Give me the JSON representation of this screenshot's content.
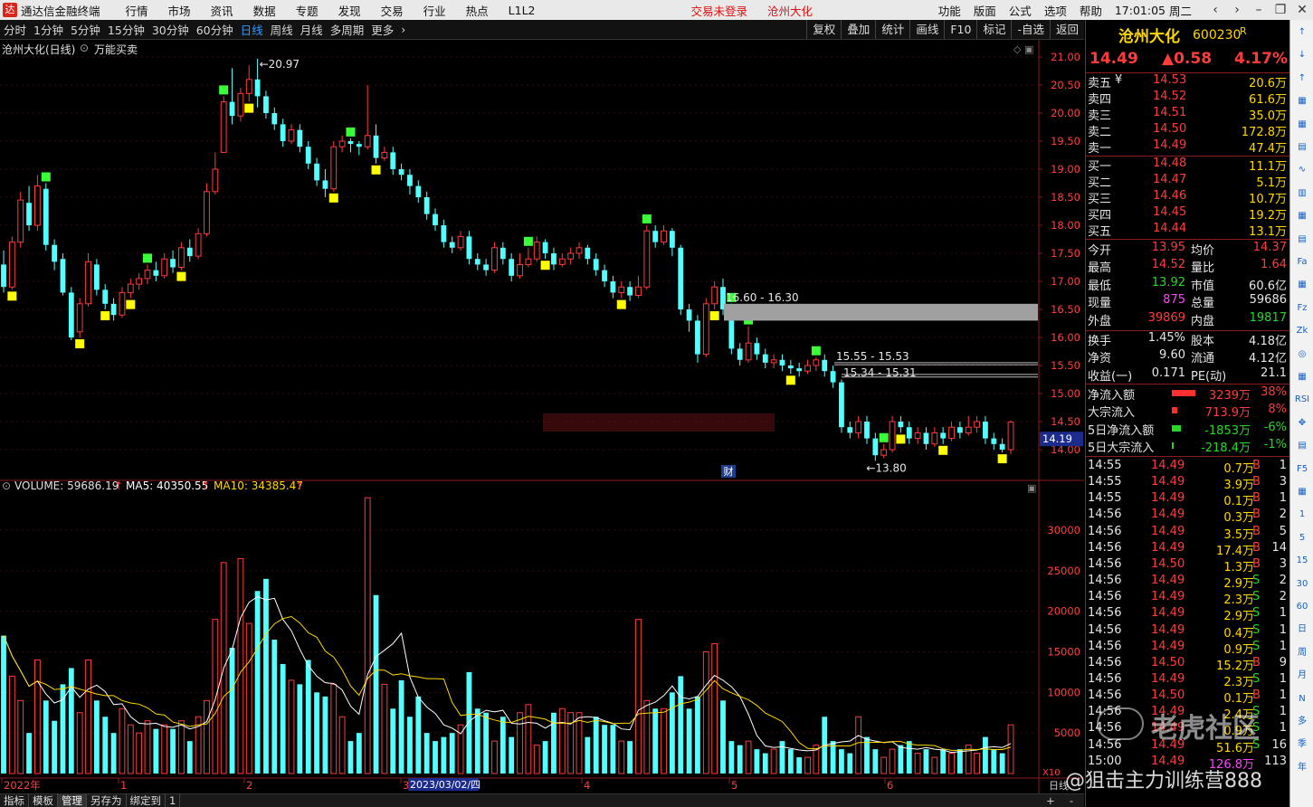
{
  "menubar": {
    "app_title": "通达信金融终端",
    "items": [
      "行情",
      "市场",
      "资讯",
      "数据",
      "专题",
      "发现",
      "交易",
      "行业",
      "热点",
      "L1L2"
    ],
    "login_status": "交易未登录",
    "stock_name": "沧州大化",
    "right_items": [
      "功能",
      "版面",
      "公式",
      "选项",
      "帮助"
    ],
    "time": "17:01:05",
    "weekday": "周二"
  },
  "periodbar": {
    "periods": [
      "分时",
      "1分钟",
      "5分钟",
      "15分钟",
      "30分钟",
      "60分钟",
      "日线",
      "周线",
      "月线",
      "多周期",
      "更多"
    ],
    "active": "日线",
    "tools": [
      "复权",
      "叠加",
      "统计",
      "画线",
      "F10",
      "标记",
      "-自选",
      "返回"
    ]
  },
  "chart": {
    "title": "沧州大化(日线)",
    "indicator": "万能买卖",
    "current_price_tag": "14.19",
    "fin_marker": "财",
    "annotations": {
      "high": "20.97",
      "low": "13.80",
      "zone1": "16.60 - 16.30",
      "zone2": "15.55 - 15.53",
      "zone3": "15.34 - 15.31"
    },
    "volume_label": "VOLUME: 59686.19",
    "ma5_label": "MA5: 40350.55",
    "ma10_label": "MA10: 34385.47",
    "x_labels": [
      "2022年",
      "1",
      "2",
      "3",
      "4",
      "5",
      "6"
    ],
    "date_cursor": "2023/03/02/四",
    "vol_unit": "日线",
    "x10": "X10"
  },
  "chart_data": {
    "type": "candlestick",
    "price_axis": {
      "min": 13.6,
      "max": 21.2,
      "ticks": [
        "21.00",
        "20.50",
        "20.00",
        "19.50",
        "19.00",
        "18.50",
        "18.00",
        "17.50",
        "17.00",
        "16.50",
        "16.00",
        "15.50",
        "15.00",
        "14.50",
        "14.00"
      ]
    },
    "volume_axis": {
      "min": 0,
      "max": 35000,
      "ticks": [
        "30000",
        "25000",
        "20000",
        "15000",
        "10000",
        "5000"
      ]
    },
    "candles": [
      [
        17.3,
        16.9,
        17.55,
        16.8
      ],
      [
        16.9,
        17.7,
        17.8,
        16.85
      ],
      [
        17.7,
        18.45,
        18.6,
        17.6
      ],
      [
        18.4,
        18.0,
        18.7,
        17.9
      ],
      [
        18.0,
        18.7,
        18.9,
        17.9
      ],
      [
        18.65,
        17.65,
        18.75,
        17.55
      ],
      [
        17.65,
        17.35,
        17.75,
        17.2
      ],
      [
        17.4,
        16.8,
        17.5,
        16.75
      ],
      [
        16.8,
        16.0,
        16.9,
        15.95
      ],
      [
        16.1,
        16.6,
        16.7,
        16.0
      ],
      [
        16.6,
        17.35,
        17.5,
        16.55
      ],
      [
        17.3,
        16.85,
        17.4,
        16.75
      ],
      [
        16.85,
        16.6,
        16.95,
        16.5
      ],
      [
        16.6,
        16.4,
        16.7,
        16.3
      ],
      [
        16.4,
        16.8,
        16.9,
        16.35
      ],
      [
        16.8,
        16.95,
        17.05,
        16.7
      ],
      [
        16.95,
        17.05,
        17.15,
        16.85
      ],
      [
        17.05,
        17.2,
        17.3,
        16.95
      ],
      [
        17.2,
        17.1,
        17.35,
        17.0
      ],
      [
        17.1,
        17.4,
        17.5,
        17.05
      ],
      [
        17.4,
        17.25,
        17.55,
        17.15
      ],
      [
        17.25,
        17.6,
        17.7,
        17.2
      ],
      [
        17.6,
        17.45,
        17.75,
        17.35
      ],
      [
        17.45,
        17.85,
        17.95,
        17.4
      ],
      [
        17.85,
        18.6,
        18.75,
        17.8
      ],
      [
        18.6,
        19.0,
        19.3,
        18.55
      ],
      [
        19.3,
        20.2,
        20.3,
        19.3
      ],
      [
        20.2,
        19.95,
        20.8,
        19.8
      ],
      [
        19.95,
        20.35,
        20.45,
        19.85
      ],
      [
        20.35,
        20.6,
        20.85,
        20.2
      ],
      [
        20.6,
        20.3,
        20.97,
        20.1
      ],
      [
        20.3,
        20.0,
        20.4,
        19.9
      ],
      [
        20.0,
        19.8,
        20.1,
        19.7
      ],
      [
        19.8,
        19.5,
        19.9,
        19.4
      ],
      [
        19.5,
        19.7,
        19.8,
        19.45
      ],
      [
        19.7,
        19.4,
        19.8,
        19.3
      ],
      [
        19.4,
        19.1,
        19.5,
        19.0
      ],
      [
        19.1,
        18.8,
        19.2,
        18.7
      ],
      [
        18.8,
        18.65,
        19.0,
        18.5
      ],
      [
        18.65,
        19.4,
        19.5,
        18.6
      ],
      [
        19.4,
        19.5,
        19.6,
        19.3
      ],
      [
        19.5,
        19.45,
        19.55,
        19.3
      ],
      [
        19.45,
        19.4,
        19.5,
        19.25
      ],
      [
        19.4,
        19.6,
        20.5,
        19.35
      ],
      [
        19.6,
        19.2,
        19.8,
        19.1
      ],
      [
        19.2,
        19.3,
        19.4,
        19.15
      ],
      [
        19.3,
        19.0,
        19.4,
        18.9
      ],
      [
        19.0,
        18.9,
        19.1,
        18.8
      ],
      [
        18.9,
        18.7,
        19.0,
        18.55
      ],
      [
        18.7,
        18.5,
        18.8,
        18.4
      ],
      [
        18.5,
        18.2,
        18.6,
        18.1
      ],
      [
        18.2,
        18.0,
        18.3,
        17.9
      ],
      [
        18.0,
        17.7,
        18.1,
        17.6
      ],
      [
        17.7,
        17.6,
        17.8,
        17.5
      ],
      [
        17.6,
        17.8,
        17.9,
        17.55
      ],
      [
        17.8,
        17.4,
        17.9,
        17.3
      ],
      [
        17.4,
        17.3,
        17.5,
        17.2
      ],
      [
        17.3,
        17.2,
        17.4,
        17.1
      ],
      [
        17.2,
        17.6,
        17.7,
        17.15
      ],
      [
        17.6,
        17.4,
        17.7,
        17.3
      ],
      [
        17.4,
        17.1,
        17.5,
        17.0
      ],
      [
        17.1,
        17.3,
        17.5,
        17.05
      ],
      [
        17.3,
        17.4,
        17.6,
        17.25
      ],
      [
        17.4,
        17.7,
        17.8,
        17.35
      ],
      [
        17.7,
        17.5,
        17.75,
        17.4
      ],
      [
        17.5,
        17.3,
        17.6,
        17.2
      ],
      [
        17.3,
        17.4,
        17.5,
        17.25
      ],
      [
        17.4,
        17.5,
        17.6,
        17.3
      ],
      [
        17.5,
        17.6,
        17.7,
        17.4
      ],
      [
        17.6,
        17.4,
        17.65,
        17.3
      ],
      [
        17.4,
        17.2,
        17.5,
        17.1
      ],
      [
        17.2,
        17.0,
        17.3,
        16.9
      ],
      [
        17.0,
        16.8,
        17.1,
        16.7
      ],
      [
        16.8,
        16.9,
        17.0,
        16.7
      ],
      [
        16.9,
        16.75,
        17.0,
        16.65
      ],
      [
        16.75,
        16.9,
        17.1,
        16.7
      ],
      [
        16.9,
        17.9,
        18.0,
        16.85
      ],
      [
        17.9,
        17.7,
        18.0,
        17.6
      ],
      [
        17.7,
        17.9,
        18.0,
        17.65
      ],
      [
        17.9,
        17.6,
        17.95,
        17.45
      ],
      [
        17.6,
        16.5,
        17.65,
        16.4
      ],
      [
        16.5,
        16.3,
        16.6,
        16.1
      ],
      [
        16.3,
        15.7,
        16.4,
        15.55
      ],
      [
        15.7,
        16.6,
        16.7,
        15.65
      ],
      [
        16.6,
        16.9,
        17.0,
        16.5
      ],
      [
        16.9,
        16.5,
        17.05,
        16.4
      ],
      [
        16.5,
        15.8,
        16.6,
        15.7
      ],
      [
        15.8,
        15.6,
        15.9,
        15.5
      ],
      [
        15.6,
        15.9,
        16.2,
        15.55
      ],
      [
        15.9,
        15.7,
        16.0,
        15.6
      ],
      [
        15.7,
        15.55,
        15.8,
        15.45
      ],
      [
        15.55,
        15.6,
        15.7,
        15.45
      ],
      [
        15.6,
        15.5,
        15.7,
        15.4
      ],
      [
        15.5,
        15.45,
        15.6,
        15.35
      ],
      [
        15.45,
        15.4,
        15.55,
        15.3
      ],
      [
        15.4,
        15.5,
        15.6,
        15.35
      ],
      [
        15.5,
        15.6,
        15.65,
        15.4
      ],
      [
        15.6,
        15.4,
        15.7,
        15.3
      ],
      [
        15.4,
        15.2,
        15.5,
        15.1
      ],
      [
        15.2,
        14.4,
        15.25,
        14.3
      ],
      [
        14.4,
        14.3,
        14.5,
        14.2
      ],
      [
        14.3,
        14.5,
        14.6,
        14.2
      ],
      [
        14.5,
        14.2,
        14.6,
        14.1
      ],
      [
        14.2,
        13.9,
        14.3,
        13.8
      ],
      [
        13.9,
        14.0,
        14.1,
        13.85
      ],
      [
        14.0,
        14.5,
        14.6,
        13.95
      ],
      [
        14.5,
        14.4,
        14.6,
        14.3
      ],
      [
        14.4,
        14.2,
        14.5,
        14.1
      ],
      [
        14.2,
        14.3,
        14.4,
        14.1
      ],
      [
        14.3,
        14.1,
        14.4,
        14.0
      ],
      [
        14.1,
        14.3,
        14.4,
        14.05
      ],
      [
        14.3,
        14.2,
        14.4,
        14.1
      ],
      [
        14.2,
        14.4,
        14.5,
        14.15
      ],
      [
        14.4,
        14.3,
        14.5,
        14.2
      ],
      [
        14.3,
        14.4,
        14.6,
        14.25
      ],
      [
        14.4,
        14.5,
        14.6,
        14.3
      ],
      [
        14.5,
        14.2,
        14.6,
        14.1
      ],
      [
        14.2,
        14.1,
        14.3,
        14.0
      ],
      [
        14.1,
        14.0,
        14.2,
        13.95
      ],
      [
        14.0,
        14.49,
        14.52,
        13.92
      ]
    ],
    "volumes": [
      17000,
      12000,
      9000,
      5000,
      14000,
      9000,
      6500,
      11000,
      13000,
      7500,
      14000,
      9000,
      7000,
      5000,
      8000,
      6000,
      5000,
      6500,
      5500,
      6000,
      5500,
      6500,
      4000,
      7000,
      9000,
      19000,
      26000,
      15500,
      26500,
      18500,
      22500,
      24000,
      16500,
      13500,
      11500,
      11000,
      14000,
      10000,
      9500,
      11000,
      7000,
      4000,
      5000,
      34000,
      22000,
      11000,
      8000,
      11500,
      7000,
      9500,
      5000,
      4000,
      4500,
      5000,
      6000,
      12500,
      8000,
      7500,
      4000,
      7000,
      4500,
      7500,
      8500,
      3500,
      4000,
      7500,
      8000,
      7500,
      7500,
      4500,
      7000,
      6000,
      6000,
      4000,
      4000,
      19000,
      9000,
      8000,
      8000,
      10000,
      12000,
      8000,
      9500,
      15000,
      16000,
      9000,
      4000,
      3500,
      4000,
      3000,
      2500,
      3000,
      4000,
      3000,
      2000,
      2000,
      3500,
      7000,
      4000,
      3000,
      2500,
      7000,
      4500,
      3000,
      2000,
      3000,
      3500,
      4000,
      2500,
      3000,
      2000,
      3000,
      2500,
      3000,
      3500,
      2500,
      4500,
      3000,
      2500,
      6000
    ],
    "buy_signals": [
      5,
      17,
      26,
      41,
      62,
      76,
      86,
      88,
      96,
      104
    ],
    "sell_signals": [
      1,
      9,
      12,
      15,
      21,
      29,
      39,
      44,
      64,
      73,
      84,
      93,
      106,
      111,
      118
    ]
  },
  "quote": {
    "name": "沧州大化",
    "code": "600230",
    "r_flag": "R",
    "price": "14.49",
    "change": "▲0.58",
    "pct": "4.17%",
    "asks": [
      {
        "label": "卖五",
        "price": "14.53",
        "vol": "20.6万"
      },
      {
        "label": "卖四",
        "price": "14.52",
        "vol": "61.6万"
      },
      {
        "label": "卖三",
        "price": "14.51",
        "vol": "35.0万"
      },
      {
        "label": "卖二",
        "price": "14.50",
        "vol": "172.8万"
      },
      {
        "label": "卖一",
        "price": "14.49",
        "vol": "47.4万"
      }
    ],
    "bids": [
      {
        "label": "买一",
        "price": "14.48",
        "vol": "11.1万"
      },
      {
        "label": "买二",
        "price": "14.47",
        "vol": "5.1万"
      },
      {
        "label": "买三",
        "price": "14.46",
        "vol": "10.7万"
      },
      {
        "label": "买四",
        "price": "14.45",
        "vol": "19.2万"
      },
      {
        "label": "买五",
        "price": "14.44",
        "vol": "13.1万"
      }
    ],
    "currency": "¥",
    "stats": [
      {
        "l1": "今开",
        "v1": "13.95",
        "l2": "均价",
        "v2": "14.37"
      },
      {
        "l1": "最高",
        "v1": "14.52",
        "l2": "量比",
        "v2": "1.64"
      },
      {
        "l1": "最低",
        "v1": "13.92",
        "l2": "市值",
        "v2": "60.6亿"
      },
      {
        "l1": "现量",
        "v1": "875",
        "l2": "总量",
        "v2": "59686"
      },
      {
        "l1": "外盘",
        "v1": "39869",
        "l2": "内盘",
        "v2": "19817"
      }
    ],
    "stats2": [
      {
        "l1": "换手",
        "v1": "1.45%",
        "l2": "股本",
        "v2": "4.18亿"
      },
      {
        "l1": "净资",
        "v1": "9.60",
        "l2": "流通",
        "v2": "4.12亿"
      },
      {
        "l1": "收益(一)",
        "v1": "0.171",
        "l2": "PE(动)",
        "v2": "21.1"
      }
    ],
    "flows": [
      {
        "label": "净流入额",
        "value": "3239万",
        "pct": "38%",
        "bar": 1.0,
        "color": "#ff3030"
      },
      {
        "label": "大宗流入",
        "value": "713.9万",
        "pct": "8%",
        "bar": 0.22,
        "color": "#ff3030"
      },
      {
        "label": "5日净流入额",
        "value": "-1853万",
        "pct": "-6%",
        "bar": 0.4,
        "color": "#26d926"
      },
      {
        "label": "5日大宗流入",
        "value": "-218.4万",
        "pct": "-1%",
        "bar": 0.06,
        "color": "#26d926"
      }
    ],
    "ticks": [
      {
        "t": "14:55",
        "p": "14.49",
        "v": "0.7万",
        "s": "B",
        "n": "1"
      },
      {
        "t": "14:55",
        "p": "14.49",
        "v": "3.9万",
        "s": "B",
        "n": "3"
      },
      {
        "t": "14:55",
        "p": "14.49",
        "v": "0.1万",
        "s": "B",
        "n": "1"
      },
      {
        "t": "14:56",
        "p": "14.49",
        "v": "0.3万",
        "s": "B",
        "n": "2"
      },
      {
        "t": "14:56",
        "p": "14.49",
        "v": "3.5万",
        "s": "B",
        "n": "5"
      },
      {
        "t": "14:56",
        "p": "14.49",
        "v": "17.4万",
        "s": "B",
        "n": "14"
      },
      {
        "t": "14:56",
        "p": "14.50",
        "v": "1.3万",
        "s": "B",
        "n": "3"
      },
      {
        "t": "14:56",
        "p": "14.49",
        "v": "2.9万",
        "s": "S",
        "n": "2"
      },
      {
        "t": "14:56",
        "p": "14.49",
        "v": "2.3万",
        "s": "S",
        "n": "2"
      },
      {
        "t": "14:56",
        "p": "14.49",
        "v": "2.9万",
        "s": "S",
        "n": "1"
      },
      {
        "t": "14:56",
        "p": "14.49",
        "v": "0.4万",
        "s": "S",
        "n": "1"
      },
      {
        "t": "14:56",
        "p": "14.49",
        "v": "0.9万",
        "s": "S",
        "n": "1"
      },
      {
        "t": "14:56",
        "p": "14.50",
        "v": "15.2万",
        "s": "B",
        "n": "9"
      },
      {
        "t": "14:56",
        "p": "14.49",
        "v": "2.3万",
        "s": "S",
        "n": "1"
      },
      {
        "t": "14:56",
        "p": "14.50",
        "v": "0.1万",
        "s": "B",
        "n": "1"
      },
      {
        "t": "14:56",
        "p": "14.49",
        "v": "2.4万",
        "s": "S",
        "n": "1"
      },
      {
        "t": "14:56",
        "p": "14.49",
        "v": "0.9万",
        "s": "S",
        "n": "1"
      },
      {
        "t": "14:56",
        "p": "14.49",
        "v": "51.6万",
        "s": "S",
        "n": "16"
      },
      {
        "t": "15:00",
        "p": "14.49",
        "v": "126.8万",
        "s": "",
        "n": "113"
      }
    ]
  },
  "tools": [
    "↑",
    "↓",
    "↑",
    "▦",
    "▦",
    "▤",
    "∿",
    "▥",
    "▦",
    "▤",
    "Fa",
    "▦",
    "Fz",
    "Zk",
    "◎",
    "▦",
    "RSI",
    "✥",
    "▤",
    "F5",
    "▦",
    "1",
    "5",
    "15",
    "30",
    "60",
    "日",
    "周",
    "月",
    "N",
    "多",
    "季",
    "年"
  ],
  "watermark": {
    "brand": "老虎社区",
    "handle": "@狙击主力训练营888"
  },
  "bottombar": [
    "指标",
    "模板",
    "管理",
    "另存为",
    "绑定到",
    "1"
  ],
  "colors": {
    "up": "#ff3c3c",
    "down": "#54ffff",
    "buy_signal": "#39ff39",
    "sell_signal": "#ffff00",
    "ma5": "#ffffff",
    "ma10": "#ffd800",
    "zone": "#a0a0a0"
  }
}
